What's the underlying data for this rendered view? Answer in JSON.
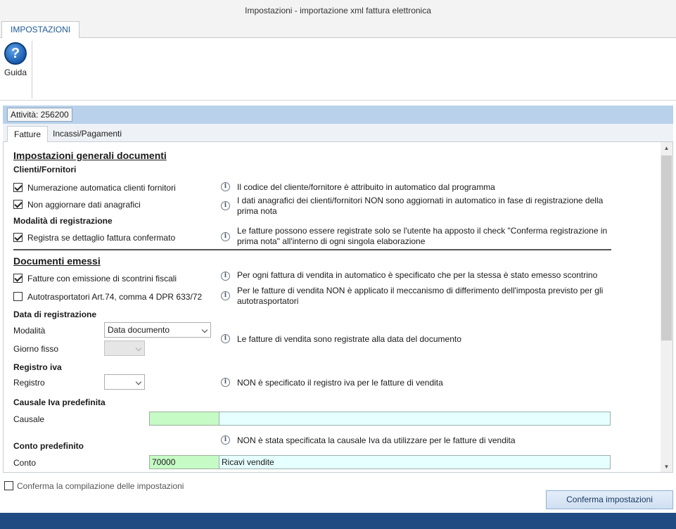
{
  "window": {
    "title": "Impostazioni - importazione xml fattura elettronica"
  },
  "ribbon": {
    "tab": "IMPOSTAZIONI",
    "help_label": "Guida",
    "help_icon": "help-question-icon"
  },
  "activity": {
    "label": "Attività: 256200"
  },
  "tabs": [
    {
      "label": "Fatture",
      "active": true
    },
    {
      "label": "Incassi/Pagamenti",
      "active": false
    }
  ],
  "general": {
    "title": "Impostazioni generali documenti",
    "clienti_title": "Clienti/Fornitori",
    "num_auto": {
      "label": "Numerazione automatica clienti fornitori",
      "checked": true,
      "info": "Il codice del cliente/fornitore è attribuito in automatico dal programma"
    },
    "no_update": {
      "label": "Non aggiornare dati anagrafici",
      "checked": true,
      "info": "I dati anagrafici dei clienti/fornitori NON sono aggiornati in automatico in fase di registrazione della prima nota"
    },
    "mod_reg_title": "Modalità di registrazione",
    "reg_detail": {
      "label": "Registra se dettaglio fattura confermato",
      "checked": true,
      "info": "Le fatture possono essere registrate solo se l'utente ha apposto il check \"Conferma registrazione in prima nota\" all'interno di ogni singola elaborazione"
    }
  },
  "emessi": {
    "title": "Documenti emessi",
    "scontrini": {
      "label": "Fatture con emissione di scontrini fiscali",
      "checked": true,
      "info": "Per ogni fattura di vendita in automatico è specificato che per la stessa è stato emesso scontrino"
    },
    "autotrasp": {
      "label": "Autotrasportatori Art.74, comma 4 DPR 633/72",
      "checked": false,
      "info": "Per le fatture di vendita NON è applicato il meccanismo di differimento dell'imposta previsto per gli autotrasportatori"
    },
    "data_reg_title": "Data di registrazione",
    "modalita_label": "Modalità",
    "modalita_value": "Data documento",
    "giorno_label": "Giorno fisso",
    "giorno_value": "",
    "data_info": "Le fatture di vendita sono registrate alla data del documento",
    "registro_title": "Registro iva",
    "registro_label": "Registro",
    "registro_value": "",
    "registro_info": "NON è specificato il registro iva per le fatture di vendita",
    "causale_title": "Causale Iva predefinita",
    "causale_label": "Causale",
    "causale_code": "",
    "causale_desc": "",
    "causale_info": "NON è stata specificata la causale Iva da utilizzare per le fatture di vendita",
    "conto_title": "Conto predefinito",
    "conto_label": "Conto",
    "conto_code": "70000",
    "conto_desc": "Ricavi vendite"
  },
  "footer": {
    "confirm_label": "Conferma la compilazione delle impostazioni",
    "confirm_checked": false,
    "button": "Conferma impostazioni"
  }
}
